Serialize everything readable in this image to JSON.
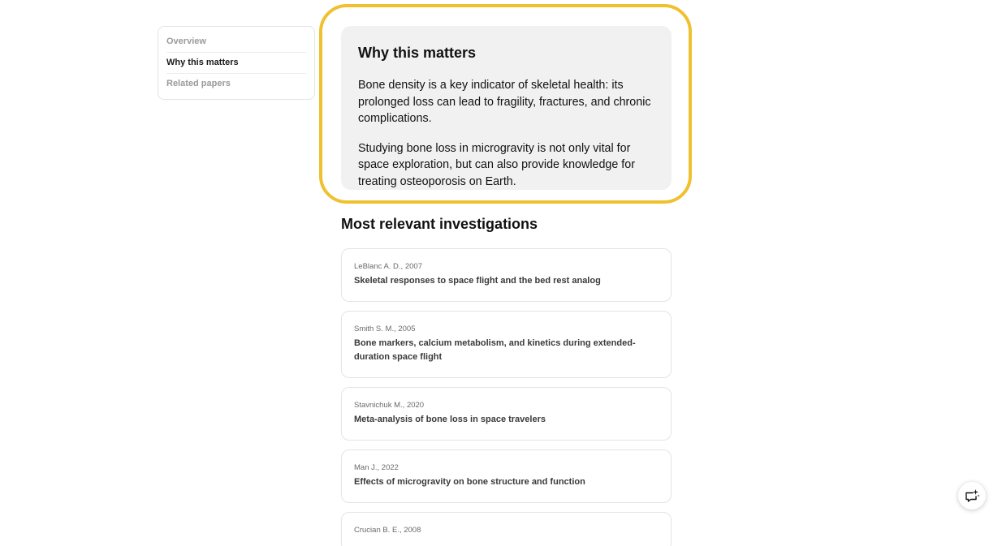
{
  "toc": {
    "items": [
      {
        "label": "Overview",
        "active": false
      },
      {
        "label": "Why this matters",
        "active": true
      },
      {
        "label": "Related papers",
        "active": false
      }
    ]
  },
  "why": {
    "title": "Why this matters",
    "paragraphs": [
      "Bone density is a key indicator of skeletal health: its prolonged loss can lead to fragility, fractures, and chronic complications.",
      "Studying bone loss in microgravity is not only vital for space exploration, but can also provide knowledge for treating osteoporosis on Earth."
    ]
  },
  "investigations": {
    "title": "Most relevant investigations",
    "items": [
      {
        "meta": "LeBlanc A. D., 2007",
        "title": "Skeletal responses to space flight and the bed rest analog"
      },
      {
        "meta": "Smith S. M., 2005",
        "title": "Bone markers, calcium metabolism, and kinetics during extended-duration space flight"
      },
      {
        "meta": "Stavnichuk M., 2020",
        "title": "Meta-analysis of bone loss in space travelers"
      },
      {
        "meta": "Man J., 2022",
        "title": "Effects of microgravity on bone structure and function"
      },
      {
        "meta": "Crucian B. E., 2008",
        "title": ""
      }
    ]
  },
  "fab": {
    "icon": "chat-sparkle-icon"
  },
  "colors": {
    "highlight": "#efc12f",
    "card_bg": "#f1f1f1",
    "border": "#e4e4e4",
    "muted_text": "#9a9a9a"
  }
}
